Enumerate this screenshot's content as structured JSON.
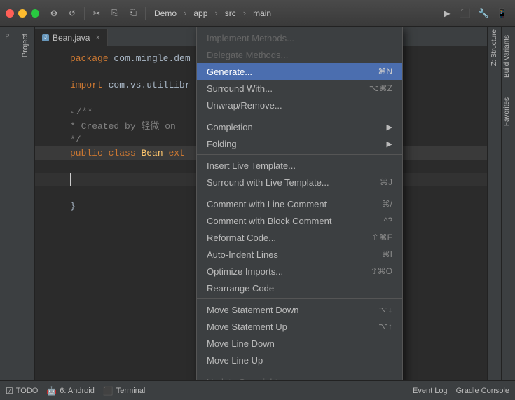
{
  "titlebar": {
    "dots": [
      "red",
      "yellow",
      "green"
    ],
    "project": "Demo",
    "module": "app",
    "src": "src",
    "main": "main"
  },
  "tab": {
    "name": "Bean.java",
    "close": "×"
  },
  "editor": {
    "lines": [
      {
        "num": "",
        "content": "package com.mingle.dem",
        "type": "package"
      },
      {
        "num": "",
        "content": "",
        "type": "blank"
      },
      {
        "num": "",
        "content": "import com.vs.utilLibr",
        "type": "import"
      },
      {
        "num": "",
        "content": "",
        "type": "blank"
      },
      {
        "num": "",
        "content": "/**",
        "type": "comment"
      },
      {
        "num": "",
        "content": " * Created by 轻微 on",
        "type": "comment"
      },
      {
        "num": "",
        "content": " */",
        "type": "comment"
      },
      {
        "num": "",
        "content": "public class Bean  ext",
        "type": "code"
      },
      {
        "num": "",
        "content": "",
        "type": "blank"
      },
      {
        "num": "",
        "content": "",
        "type": "cursor"
      },
      {
        "num": "",
        "content": "",
        "type": "blank"
      },
      {
        "num": "",
        "content": "}",
        "type": "code"
      }
    ]
  },
  "contextMenu": {
    "items": [
      {
        "label": "Implement Methods...",
        "shortcut": "",
        "disabled": false,
        "separator": false,
        "hasArrow": false
      },
      {
        "label": "Delegate Methods...",
        "shortcut": "",
        "disabled": false,
        "separator": false,
        "hasArrow": false
      },
      {
        "label": "Generate...",
        "shortcut": "⌘N",
        "disabled": false,
        "separator": false,
        "hasArrow": false,
        "highlighted": true
      },
      {
        "label": "Surround With...",
        "shortcut": "⌥⌘Z",
        "disabled": false,
        "separator": false,
        "hasArrow": false
      },
      {
        "label": "Unwrap/Remove...",
        "shortcut": "",
        "disabled": false,
        "separator": false,
        "hasArrow": false
      },
      {
        "separator": true
      },
      {
        "label": "Completion",
        "shortcut": "",
        "disabled": false,
        "hasArrow": true
      },
      {
        "label": "Folding",
        "shortcut": "",
        "disabled": false,
        "hasArrow": true
      },
      {
        "separator": true
      },
      {
        "label": "Insert Live Template...",
        "shortcut": "",
        "disabled": false
      },
      {
        "label": "Surround with Live Template...",
        "shortcut": "⌘J",
        "disabled": false
      },
      {
        "separator": true
      },
      {
        "label": "Comment with Line Comment",
        "shortcut": "⌘/",
        "disabled": false
      },
      {
        "label": "Comment with Block Comment",
        "shortcut": "^?",
        "disabled": false
      },
      {
        "label": "Reformat Code...",
        "shortcut": "⇧⌘F",
        "disabled": false
      },
      {
        "label": "Auto-Indent Lines",
        "shortcut": "⌘I",
        "disabled": false
      },
      {
        "label": "Optimize Imports...",
        "shortcut": "⇧⌘O",
        "disabled": false
      },
      {
        "label": "Rearrange Code",
        "shortcut": "",
        "disabled": false
      },
      {
        "separator": true
      },
      {
        "label": "Move Statement Down",
        "shortcut": "⌥↓",
        "disabled": false
      },
      {
        "label": "Move Statement Up",
        "shortcut": "⌥↑",
        "disabled": false
      },
      {
        "label": "Move Line Down",
        "shortcut": "",
        "disabled": false
      },
      {
        "label": "Move Line Up",
        "shortcut": "",
        "disabled": false
      },
      {
        "separator": true
      },
      {
        "label": "Update Copyright...",
        "shortcut": "",
        "disabled": true
      }
    ]
  },
  "submenu": {
    "completionLabel": "Completion",
    "foldingLabel": "Folding"
  },
  "bottomBar": {
    "todo": "TODO",
    "android": "6: Android",
    "terminal": "Terminal",
    "eventLog": "Event Log",
    "gradleConsole": "Gradle Console"
  },
  "sidePanels": {
    "project": "Project",
    "structure": "Z: Structure",
    "buildVariants": "Build Variants",
    "favorites": "Favorites"
  }
}
